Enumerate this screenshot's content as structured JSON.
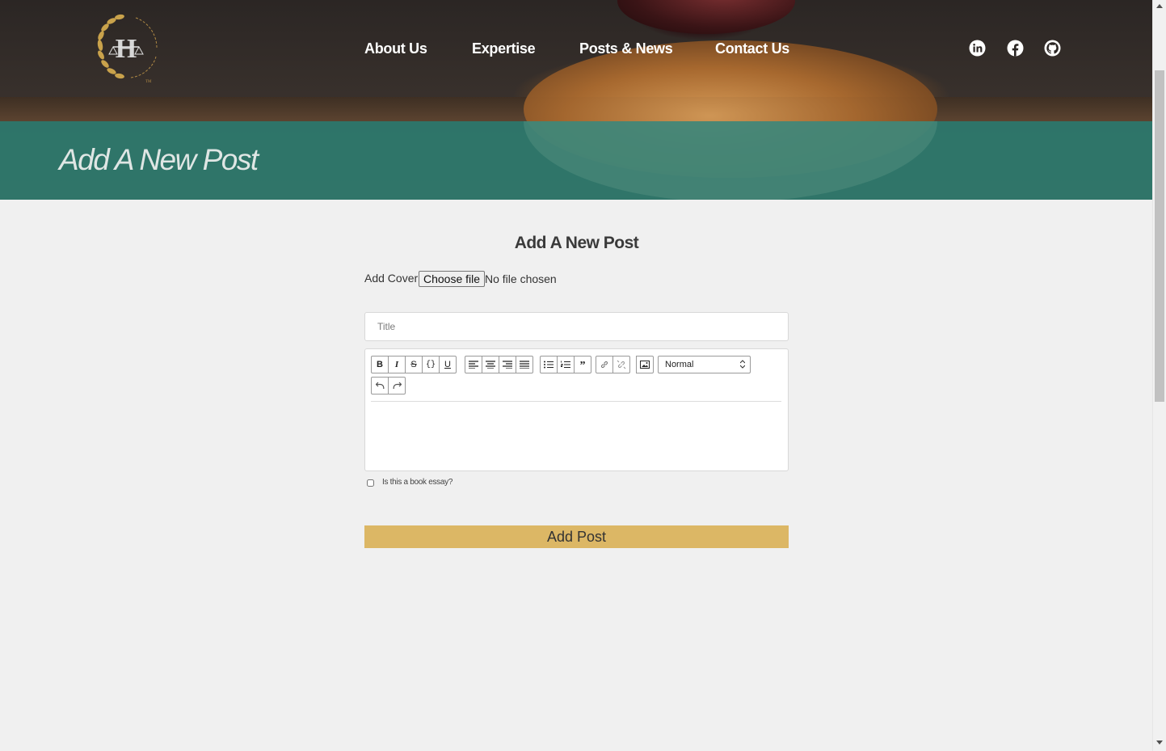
{
  "header": {
    "logo_text": "H",
    "nav": [
      {
        "label": "About Us"
      },
      {
        "label": "Expertise"
      },
      {
        "label": "Posts & News"
      },
      {
        "label": "Contact Us"
      }
    ],
    "social_icons": [
      "linkedin-icon",
      "facebook-icon",
      "github-icon"
    ]
  },
  "banner": {
    "title": "Add A New Post"
  },
  "form": {
    "heading": "Add A New Post",
    "cover_label": "Add Cover",
    "choose_file_label": "Choose file",
    "no_file_text": "No file chosen",
    "title_placeholder": "Title",
    "editor": {
      "toolbar_groups": [
        [
          "bold-icon",
          "italic-icon",
          "strikethrough-icon",
          "code-icon",
          "underline-icon"
        ],
        [
          "align-left-icon",
          "align-center-icon",
          "align-right-icon",
          "align-justify-icon"
        ],
        [
          "bullet-list-icon",
          "numbered-list-icon",
          "blockquote-icon"
        ],
        [
          "link-icon",
          "unlink-icon"
        ],
        [
          "image-icon"
        ],
        [
          "undo-icon",
          "redo-icon"
        ]
      ],
      "block_type_value": "Normal"
    },
    "book_essay_label": "Is this a book essay?",
    "book_essay_checked": false,
    "submit_label": "Add Post"
  },
  "colors": {
    "banner_teal": "#2d7a6e",
    "submit_gold": "#dcb765",
    "page_bg": "#f0f0f0"
  }
}
